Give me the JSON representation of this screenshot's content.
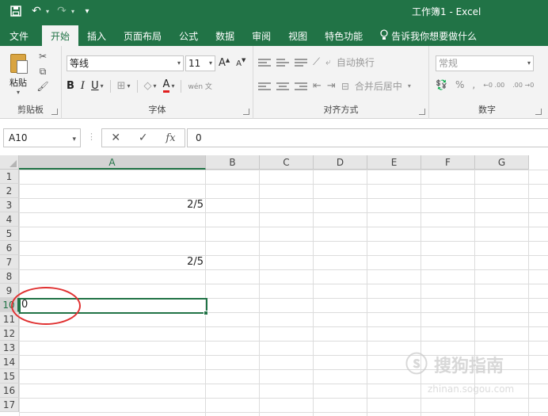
{
  "title_bar": {
    "window_title": "工作簿1  -  Excel",
    "quick_access": [
      {
        "icon": "save-icon"
      },
      {
        "icon": "undo-icon"
      },
      {
        "icon": "redo-icon"
      },
      {
        "icon": "customize-icon"
      }
    ]
  },
  "tabs": [
    "文件",
    "开始",
    "插入",
    "页面布局",
    "公式",
    "数据",
    "审阅",
    "视图",
    "特色功能"
  ],
  "active_tab": "开始",
  "tell_me": "告诉我你想要做什么",
  "ribbon": {
    "clipboard": {
      "paste_label": "粘贴",
      "group_label": "剪贴板"
    },
    "font": {
      "font_name": "等线",
      "font_size": "11",
      "grow": "A",
      "shrink": "A",
      "bold": "B",
      "italic": "I",
      "underline": "U",
      "font_color": "A",
      "phonetic": "wén 文",
      "group_label": "字体"
    },
    "alignment": {
      "wrap_text": "自动换行",
      "merge_center": "合并后居中",
      "group_label": "对齐方式"
    },
    "number": {
      "format": "常规",
      "percent": "%",
      "comma": ",",
      "inc_decimal": "←0 .00",
      "dec_decimal": ".00 →0",
      "group_label": "数字"
    }
  },
  "formula_bar": {
    "name_box": "A10",
    "cancel": "✕",
    "enter": "✓",
    "fx": "fx",
    "content": "0"
  },
  "grid": {
    "columns": [
      "A",
      "B",
      "C",
      "D",
      "E",
      "F",
      "G"
    ],
    "rows": [
      "1",
      "2",
      "3",
      "4",
      "5",
      "6",
      "7",
      "8",
      "9",
      "10",
      "11",
      "12",
      "13",
      "14",
      "15",
      "16",
      "17"
    ],
    "selected_column": "A",
    "selected_row": "10",
    "cells": {
      "A3": "2/5",
      "A7": "2/5",
      "A10": "0"
    }
  },
  "watermark": {
    "brand": "搜狗指南",
    "url": "zhinan.sogou.com"
  },
  "colors": {
    "accent": "#217346",
    "annotation": "#e03131"
  }
}
